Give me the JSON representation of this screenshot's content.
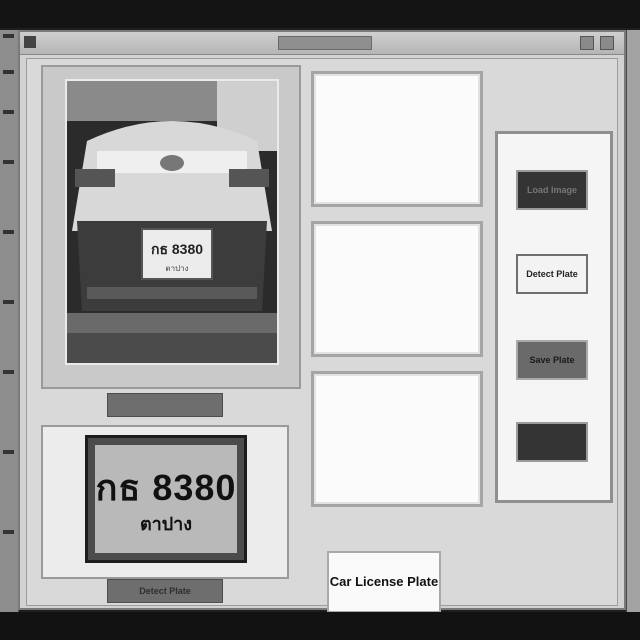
{
  "window": {
    "title": ""
  },
  "photo": {
    "caption": ""
  },
  "plate": {
    "number": "กธ 8380",
    "province": "ตาปาง",
    "caption": "Detect Plate"
  },
  "controls": {
    "load_label": "Load Image",
    "detect_label": "Detect Plate",
    "save_label": "Save Plate",
    "other_label": ""
  },
  "app_title": "Car License Plate",
  "colors": {
    "accent": "#343434",
    "panel": "#d9d9d9",
    "result_bg": "#fbfbfb"
  }
}
